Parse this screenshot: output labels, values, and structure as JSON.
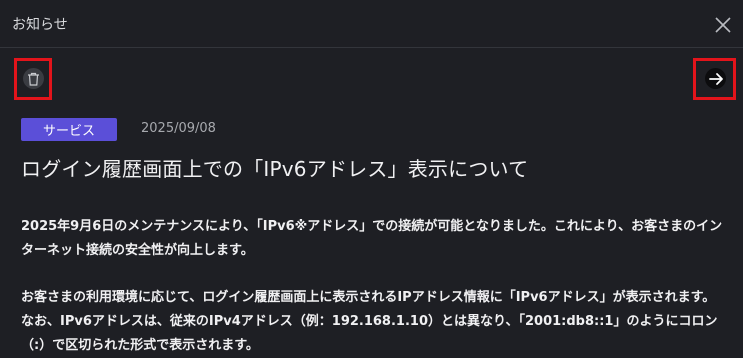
{
  "header": {
    "title": "お知らせ",
    "close_icon": "close-icon"
  },
  "toolbar": {
    "delete_icon": "trash-icon",
    "next_icon": "arrow-right-icon"
  },
  "article": {
    "category": "サービス",
    "date": "2025/09/08",
    "title": "ログイン履歴画面上での「IPv6アドレス」表示について",
    "paragraphs": [
      "2025年9月6日のメンテナンスにより、「IPv6※アドレス」での接続が可能となりました。これにより、お客さまのインターネット接続の安全性が向上します。",
      "お客さまの利用環境に応じて、ログイン履歴画面上に表示されるIPアドレス情報に「IPv6アドレス」が表示されます。なお、IPv6アドレスは、従来のIPv4アドレス（例：192.168.1.10）とは異なり、「2001:db8::1」のようにコロン（:）で区切られた形式で表示されます。"
    ]
  },
  "colors": {
    "accent": "#5b4fd8",
    "highlight": "#e3141b",
    "background": "#1e1f24"
  }
}
